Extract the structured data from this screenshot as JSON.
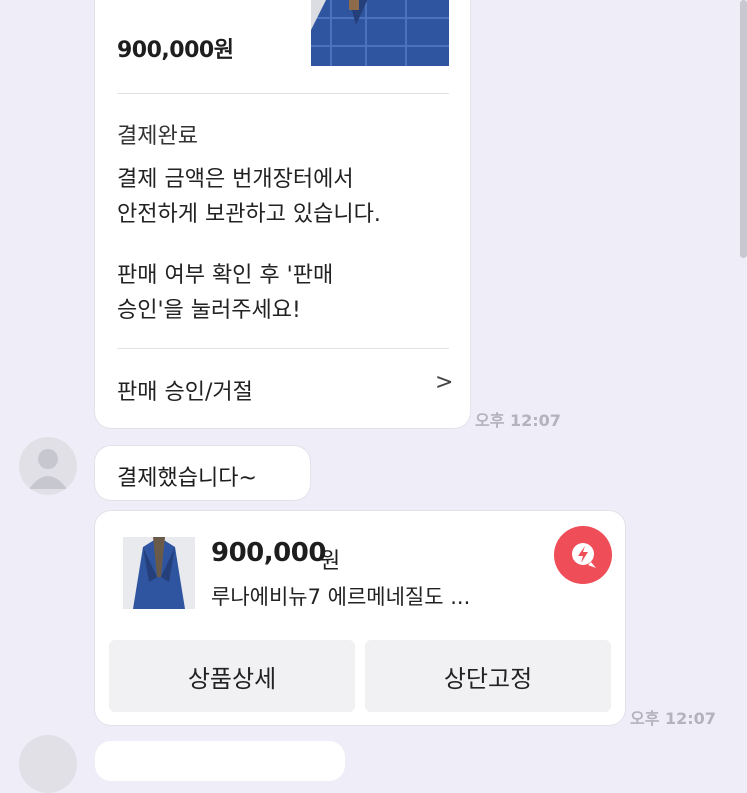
{
  "payment_card": {
    "price": "900,000원",
    "status": "결제완료",
    "message_line1": "결제 금액은 번개장터에서",
    "message_line2": "안전하게 보관하고 있습니다.",
    "message_line3": "판매 여부 확인 후 '판매",
    "message_line4": "승인'을 눌러주세요!",
    "action_label": "판매 승인/거절",
    "chevron": ">",
    "time": "오후 12:07"
  },
  "buyer_message": {
    "text": "결제했습니다~"
  },
  "product_card": {
    "price": "900,000",
    "currency": "원",
    "title": "루나에비뉴7 에르메네질도 ...",
    "detail_button": "상품상세",
    "pin_button": "상단고정",
    "time": "오후 12:07",
    "badge_icon": "bunjang-lightning-icon"
  },
  "colors": {
    "background": "#efedf7",
    "card": "#ffffff",
    "badge": "#ef4d57",
    "jacket_blue": "#3a5fa8"
  }
}
